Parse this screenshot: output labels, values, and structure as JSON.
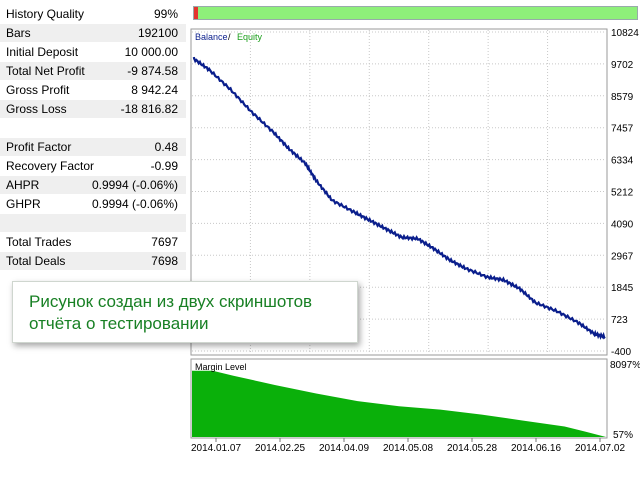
{
  "stats": [
    {
      "label": "History Quality",
      "value": "99%",
      "shade": false
    },
    {
      "label": "Bars",
      "value": "192100",
      "shade": true
    },
    {
      "label": "Initial Deposit",
      "value": "10 000.00",
      "shade": false
    },
    {
      "label": "Total Net Profit",
      "value": "-9 874.58",
      "shade": true
    },
    {
      "label": "Gross Profit",
      "value": "8 942.24",
      "shade": false
    },
    {
      "label": "Gross Loss",
      "value": "-18 816.82",
      "shade": true
    },
    {
      "label": "",
      "value": "",
      "shade": false
    },
    {
      "label": "Profit Factor",
      "value": "0.48",
      "shade": true
    },
    {
      "label": "Recovery Factor",
      "value": "-0.99",
      "shade": false
    },
    {
      "label": "AHPR",
      "value": "0.9994 (-0.06%)",
      "shade": true
    },
    {
      "label": "GHPR",
      "value": "0.9994 (-0.06%)",
      "shade": false
    },
    {
      "label": "",
      "value": "",
      "shade": true
    },
    {
      "label": "Total Trades",
      "value": "7697",
      "shade": false
    },
    {
      "label": "Total Deals",
      "value": "7698",
      "shade": true
    }
  ],
  "quality_bar": {
    "fill_fraction": 0.99,
    "ok_color": "#8ef07a",
    "bad_color": "#e4342e"
  },
  "caption": {
    "line1": "Рисунок создан из двух скриншотов",
    "line2": "отчёта о тестировании",
    "color": "#188024"
  },
  "chart_data": [
    {
      "type": "line",
      "legend": {
        "balance": "Balance",
        "separator": " / ",
        "equity": "Equity"
      },
      "colors": {
        "balance": "#0a1e8c",
        "equity": "#1a9e1a"
      },
      "ylim": [
        -400,
        10824
      ],
      "yticks": [
        10824,
        9702,
        8579,
        7457,
        6334,
        5212,
        4090,
        2967,
        1845,
        723,
        -400
      ],
      "ytick_labels": [
        "10824",
        "9702",
        "8579",
        "7457",
        "6334",
        "5212",
        "4090",
        "2967",
        "1845",
        "723",
        "-400"
      ],
      "x_index_range": [
        0,
        7698
      ],
      "series": [
        {
          "name": "Balance",
          "x": [
            0,
            300,
            700,
            1100,
            1500,
            1800,
            2100,
            2300,
            2600,
            3000,
            3300,
            3600,
            3900,
            4200,
            4500,
            4800,
            5100,
            5500,
            5800,
            6100,
            6400,
            6800,
            7200,
            7500,
            7698
          ],
          "values": [
            9900,
            9500,
            8800,
            8000,
            7300,
            6700,
            6200,
            5600,
            4900,
            4500,
            4200,
            3900,
            3600,
            3550,
            3200,
            2800,
            2500,
            2200,
            2100,
            1800,
            1300,
            1000,
            600,
            200,
            100
          ]
        }
      ]
    },
    {
      "type": "area",
      "title": "Margin Level",
      "color": "#0ab00a",
      "ylim": [
        57,
        8097
      ],
      "ytick_labels": [
        "8097%",
        "57%"
      ],
      "xtick_labels": [
        "2014.01.07",
        "2014.02.25",
        "2014.04.09",
        "2014.05.08",
        "2014.05.28",
        "2014.06.16",
        "2014.07.02"
      ],
      "x": [
        0,
        0.05,
        0.1,
        0.2,
        0.3,
        0.4,
        0.5,
        0.6,
        0.7,
        0.8,
        0.9,
        0.95,
        1.0
      ],
      "values": [
        7900,
        7900,
        7300,
        6200,
        5200,
        4300,
        3700,
        3300,
        2700,
        2000,
        1300,
        700,
        57
      ]
    }
  ]
}
